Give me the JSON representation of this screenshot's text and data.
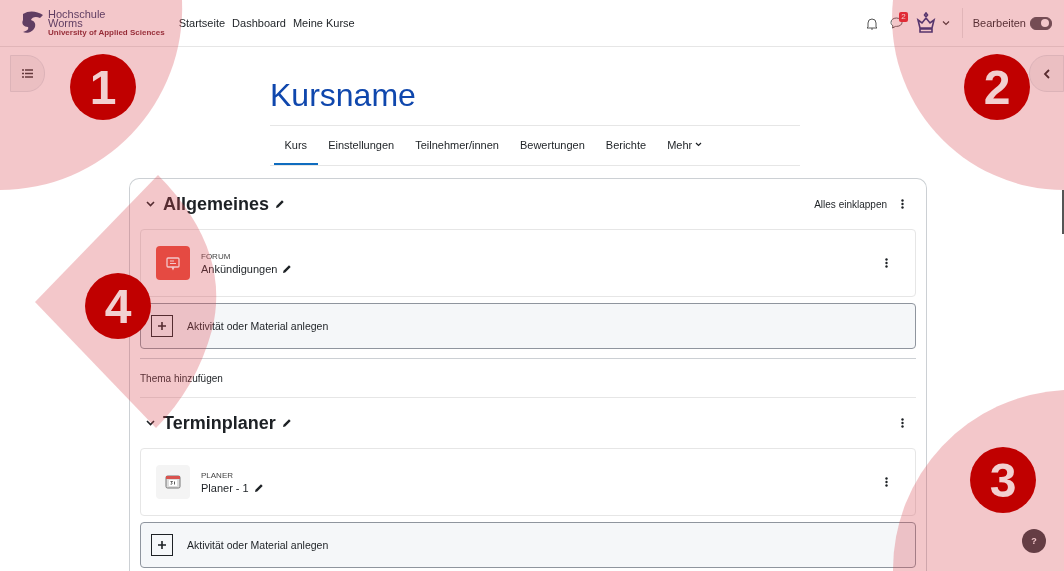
{
  "navbar": {
    "logo_lines": [
      "Hochschule",
      "Worms"
    ],
    "logo_tagline": "University of Applied Sciences",
    "links": [
      {
        "label": "Startseite"
      },
      {
        "label": "Dashboard"
      },
      {
        "label": "Meine Kurse"
      }
    ],
    "message_badge": "2",
    "edit_mode": {
      "label": "Bearbeiten",
      "on": true
    }
  },
  "course": {
    "title": "Kursname",
    "tabs": [
      {
        "label": "Kurs",
        "selected": true,
        "menu": false
      },
      {
        "label": "Einstellungen",
        "selected": false,
        "menu": false
      },
      {
        "label": "Teilnehmer/innen",
        "selected": false,
        "menu": false
      },
      {
        "label": "Bewertungen",
        "selected": false,
        "menu": false
      },
      {
        "label": "Berichte",
        "selected": false,
        "menu": false
      },
      {
        "label": "Mehr",
        "selected": false,
        "menu": true
      }
    ],
    "collapse_all": "Alles einklappen",
    "sections": [
      {
        "title": "Allgemeines",
        "expanded": true,
        "activities": [
          {
            "kind": "forum",
            "type": "FORUM",
            "name": "Ankündigungen"
          }
        ],
        "add_label": "Aktivität oder Material anlegen",
        "add_topic": "Thema hinzufügen"
      },
      {
        "title": "Terminplaner",
        "expanded": true,
        "activities": [
          {
            "kind": "planner",
            "type": "PLANER",
            "name": "Planer - 1"
          }
        ],
        "add_label": "Aktivität oder Material anlegen"
      }
    ]
  },
  "help_button": "?",
  "annotations": [
    {
      "number": "1"
    },
    {
      "number": "2"
    },
    {
      "number": "4"
    },
    {
      "number": "3"
    }
  ]
}
